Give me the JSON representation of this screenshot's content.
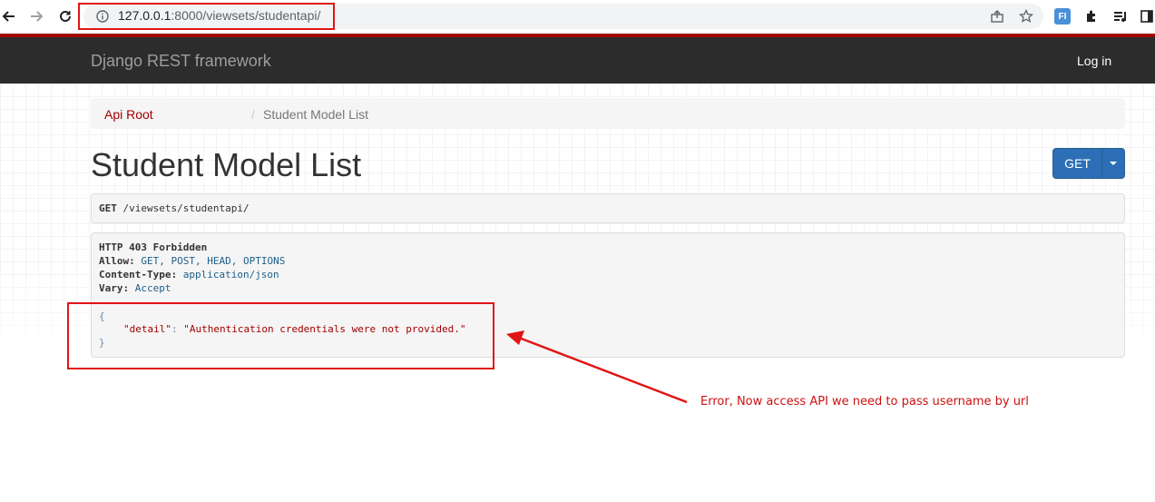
{
  "browser": {
    "url_host": "127.0.0.1",
    "url_rest": ":8000/viewsets/studentapi/",
    "extension_label": "FI"
  },
  "navbar": {
    "brand": "Django REST framework",
    "login": "Log in"
  },
  "breadcrumb": {
    "root": "Api Root",
    "separator": "/",
    "current": "Student Model List"
  },
  "page": {
    "title": "Student Model List",
    "get_button": "GET"
  },
  "request": {
    "method": "GET",
    "path": "/viewsets/studentapi/"
  },
  "response": {
    "status": "HTTP 403 Forbidden",
    "headers": [
      {
        "key": "Allow:",
        "value": "GET, POST, HEAD, OPTIONS"
      },
      {
        "key": "Content-Type:",
        "value": "application/json"
      },
      {
        "key": "Vary:",
        "value": "Accept"
      }
    ],
    "json_open": "{",
    "json_key": "\"detail\"",
    "json_colon": ": ",
    "json_value": "\"Authentication credentials were not provided.\"",
    "json_close": "}"
  },
  "annotation": {
    "text": "Error, Now access API we need to  pass username by url",
    "color": "#cc1111"
  },
  "colors": {
    "brand_red": "#a30000",
    "navbar_bg": "#2c2c2c",
    "button_blue": "#2c6fb6",
    "highlight_red": "#e01515"
  }
}
